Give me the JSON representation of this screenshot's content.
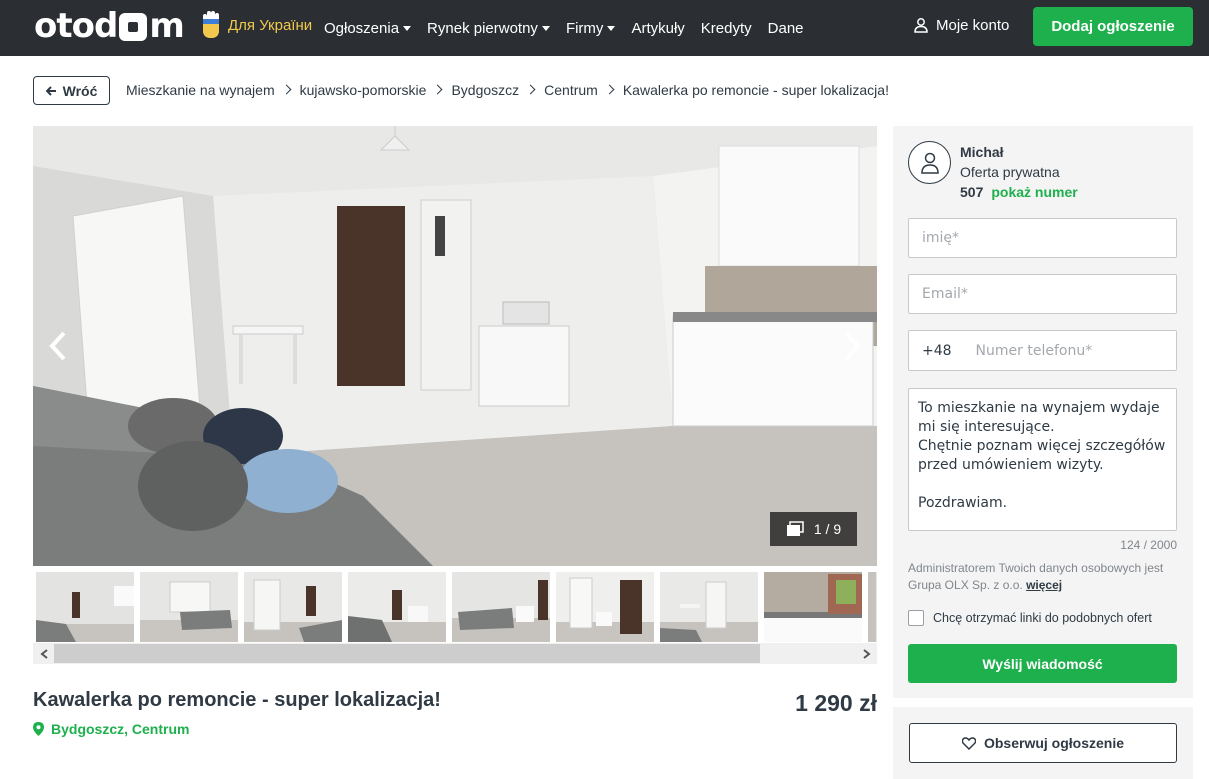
{
  "nav": {
    "logo_part1": "otod",
    "logo_part2": "m",
    "ukraine_label": "Для України",
    "menu": [
      {
        "label": "Ogłoszenia",
        "dropdown": true
      },
      {
        "label": "Rynek pierwotny",
        "dropdown": true
      },
      {
        "label": "Firmy",
        "dropdown": true
      },
      {
        "label": "Artykuły",
        "dropdown": false
      },
      {
        "label": "Kredyty",
        "dropdown": false
      },
      {
        "label": "Dane",
        "dropdown": false
      }
    ],
    "account_label": "Moje konto",
    "add_label": "Dodaj ogłoszenie"
  },
  "breadcrumb": {
    "back_label": "Wróć",
    "items": [
      "Mieszkanie na wynajem",
      "kujawsko-pomorskie",
      "Bydgoszcz",
      "Centrum",
      "Kawalerka po remoncie - super lokalizacja!"
    ]
  },
  "gallery": {
    "counter": "1 / 9",
    "thumbnail_count": 9
  },
  "listing": {
    "title": "Kawalerka po remoncie - super lokalizacja!",
    "price": "1 290 zł",
    "location": "Bydgoszcz, Centrum"
  },
  "contact": {
    "name": "Michał",
    "offer_type": "Oferta prywatna",
    "phone_prefix": "507",
    "show_number": "pokaż numer",
    "name_placeholder": "imię*",
    "email_placeholder": "Email*",
    "phone_country": "+48",
    "phone_placeholder": "Numer telefonu*",
    "message": "To mieszkanie na wynajem wydaje mi się interesujące.\nChętnie poznam więcej szczegółów przed umówieniem wizyty.\n\nPozdrawiam.",
    "char_count": "124 / 2000",
    "gdpr_text": "Administratorem Twoich danych osobowych jest Grupa OLX Sp. z o.o.",
    "gdpr_link": "więcej",
    "checkbox_label": "Chcę otrzymać linki do podobnych ofert",
    "send_label": "Wyślij wiadomość"
  },
  "watch": {
    "label": "Obserwuj ogłoszenie"
  },
  "colors": {
    "brand_green": "#1eb04d",
    "nav_bg": "#2b2f33",
    "ua_yellow": "#f2c94c"
  }
}
